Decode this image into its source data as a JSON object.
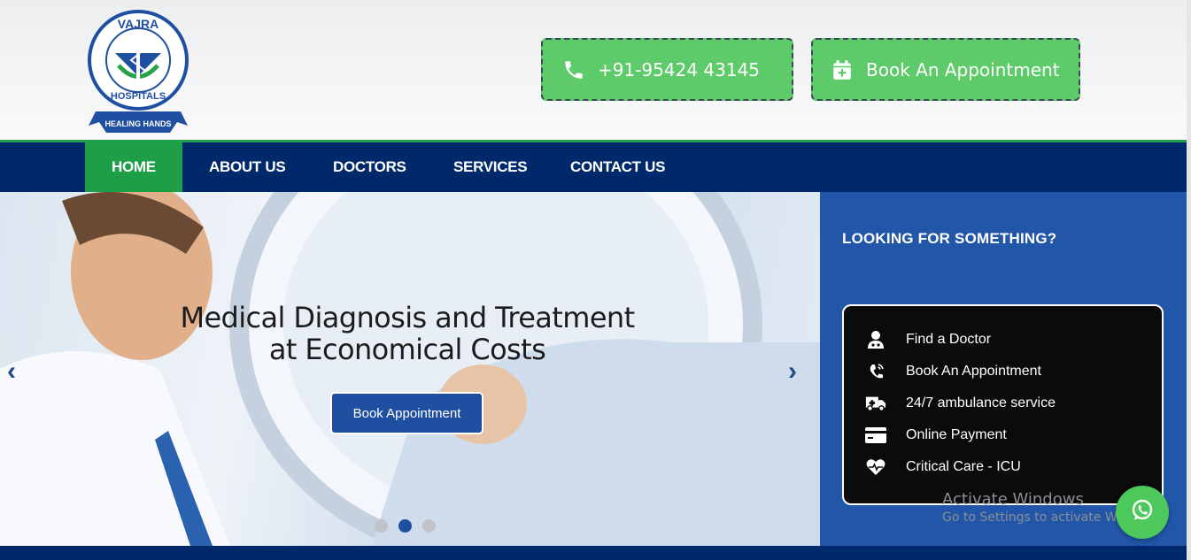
{
  "header": {
    "logo": {
      "top_text": "VAJRA",
      "bottom_text": "HOSPITALS",
      "ribbon": "HEALING HANDS"
    },
    "phone": {
      "label": "+91-95424 43145",
      "icon": "phone-icon"
    },
    "appointment": {
      "label": "Book An Appointment",
      "icon": "calendar-plus-icon"
    }
  },
  "nav": {
    "items": [
      {
        "label": "HOME",
        "active": true
      },
      {
        "label": "ABOUT US"
      },
      {
        "label": "DOCTORS"
      },
      {
        "label": "SERVICES"
      },
      {
        "label": "CONTACT US"
      }
    ]
  },
  "hero": {
    "title_line1": "Medical Diagnosis and Treatment",
    "title_line2": "at Economical Costs",
    "button": "Book Appointment",
    "prev_icon": "chevron-left-icon",
    "next_icon": "chevron-right-icon",
    "slides": 3,
    "active_slide": 2
  },
  "sidebar": {
    "title": "LOOKING FOR SOMETHING?",
    "services": [
      {
        "label": "Find a Doctor",
        "icon": "doctor-icon"
      },
      {
        "label": "Book An Appointment",
        "icon": "phone-ring-icon"
      },
      {
        "label": "24/7 ambulance service",
        "icon": "ambulance-icon"
      },
      {
        "label": "Online Payment",
        "icon": "credit-card-icon"
      },
      {
        "label": "Critical Care - ICU",
        "icon": "heartbeat-icon"
      }
    ]
  },
  "overlay": {
    "watermark_title": "Activate Windows",
    "watermark_sub": "Go to Settings to activate Windows.",
    "whatsapp_icon": "whatsapp-icon"
  },
  "colors": {
    "nav_bg": "#00296b",
    "accent_green": "#1e9e47",
    "cta_green": "#5ecb6a",
    "panel_blue": "#2256a8",
    "button_blue": "#1f4fa0"
  }
}
